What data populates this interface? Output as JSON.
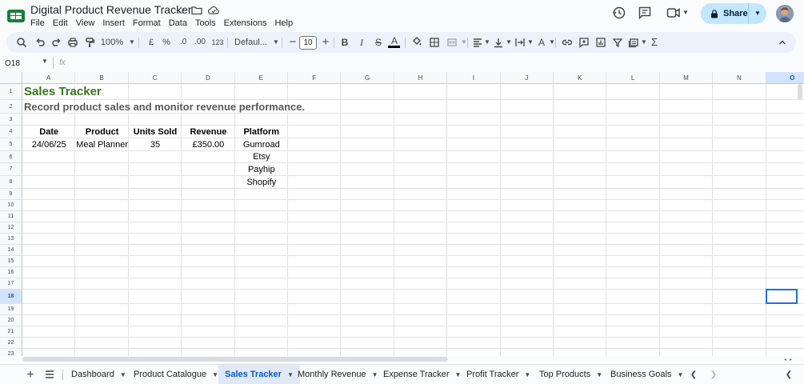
{
  "app": {
    "title": "Digital Product Revenue Tracker",
    "menu": [
      "File",
      "Edit",
      "View",
      "Insert",
      "Format",
      "Data",
      "Tools",
      "Extensions",
      "Help"
    ],
    "share_label": "Share",
    "accent": "#1a73e8",
    "brand_green": "#188038"
  },
  "toolbar": {
    "zoom": "100%",
    "currency": "£",
    "percent": "%",
    "dec_decrease": ".0",
    "dec_increase": ".00",
    "number_format": "123",
    "font": "Defaul...",
    "font_size": "10"
  },
  "formula_bar": {
    "cell_ref": "O18",
    "fx": "fx",
    "value": ""
  },
  "grid": {
    "columns": [
      "A",
      "B",
      "C",
      "D",
      "E",
      "F",
      "G",
      "H",
      "I",
      "J",
      "K",
      "L",
      "M",
      "N",
      "O"
    ],
    "selected_column": "O",
    "rows": [
      "1",
      "2",
      "3",
      "4",
      "5",
      "6",
      "7",
      "8",
      "9",
      "10",
      "11",
      "12",
      "13",
      "14",
      "15",
      "16",
      "17",
      "18",
      "19",
      "20",
      "21",
      "22",
      "23"
    ],
    "selected_row": "18",
    "title": "Sales Tracker",
    "subtitle": "Record product sales and monitor revenue performance.",
    "headers": [
      "Date",
      "Product",
      "Units Sold",
      "Revenue",
      "Platform"
    ],
    "row5": [
      "24/06/25",
      "Meal Planner",
      "35",
      "£350.00",
      "Gumroad"
    ],
    "platforms": [
      "Etsy",
      "Payhip",
      "Shopify"
    ]
  },
  "sheets": {
    "tabs": [
      "Dashboard",
      "Product Catalogue",
      "Sales Tracker",
      "Monthly Revenue",
      "Expense Tracker",
      "Profit Tracker",
      "Top Products",
      "Business Goals"
    ],
    "active": "Sales Tracker"
  }
}
